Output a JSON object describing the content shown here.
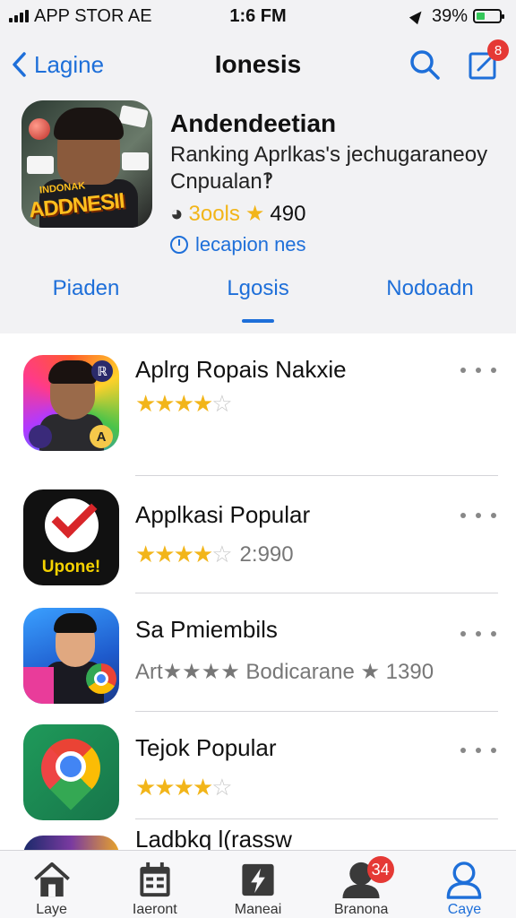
{
  "status_bar": {
    "carrier": "APP STOR  AE",
    "time": "1:6 FM",
    "battery": "39%",
    "battery_level": 0.39
  },
  "nav": {
    "back_label": "Lagine",
    "title": "Ionesis",
    "notification_count": "8"
  },
  "feature": {
    "art_text": "ADDNESII",
    "art_text_small": "INDONAK",
    "title": "Andendeetian",
    "subtitle": "Ranking Aprlkas's jechugaraneoy Cnpualan‽",
    "rating_label": "3ools",
    "rating_value": "490",
    "link_label": "lecapion nes",
    "tabs": [
      "Piaden",
      "Lgosis",
      "Nodoadn"
    ],
    "active_tab": 1
  },
  "apps": [
    {
      "title": "Aplrg Ropais Nakxie",
      "rating": 3.5,
      "meta": "",
      "icon": "portrait-app-icon"
    },
    {
      "title": "Applkasi Popular",
      "rating": 3.5,
      "meta": "2:990",
      "icon": "checkmark-app-icon"
    },
    {
      "title": "Sa Pmiembils",
      "rating": 0,
      "meta": "Art★★★★ Bodicarane ★  1390",
      "icon": "profile-chrome-app-icon"
    },
    {
      "title": "Tejok Popular",
      "rating": 4,
      "meta": "",
      "icon": "map-pin-app-icon"
    },
    {
      "title": "Ladbkq l(rassw",
      "rating": 0,
      "meta": "",
      "icon": "partial-app-icon"
    }
  ],
  "icon_labels": {
    "app1_badge_top": "ℝ",
    "app1_badge_bottom": "A",
    "app2_label": "Upone!"
  },
  "tab_bar": {
    "items": [
      "Laye",
      "Iaeront",
      "Maneai",
      "Branona",
      "Caye"
    ],
    "badge": "34",
    "active": 4
  },
  "colors": {
    "accent": "#1e6fd9",
    "star": "#f2b519",
    "badge": "#e53935",
    "battery": "#34c759"
  }
}
